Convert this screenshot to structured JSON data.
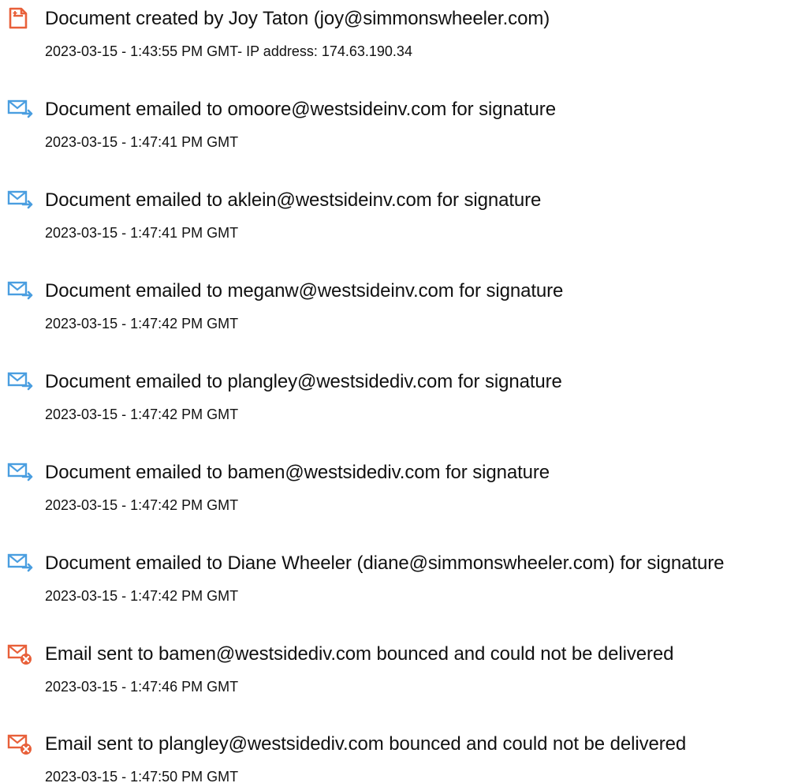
{
  "entries": [
    {
      "icon": "document-created-icon",
      "title": "Document created by Joy Taton (joy@simmonswheeler.com)",
      "meta": "2023-03-15 - 1:43:55 PM GMT- IP address: 174.63.190.34"
    },
    {
      "icon": "email-sent-icon",
      "title": "Document emailed to omoore@westsideinv.com for signature",
      "meta": "2023-03-15 - 1:47:41 PM GMT"
    },
    {
      "icon": "email-sent-icon",
      "title": "Document emailed to aklein@westsideinv.com for signature",
      "meta": "2023-03-15 - 1:47:41 PM GMT"
    },
    {
      "icon": "email-sent-icon",
      "title": "Document emailed to meganw@westsideinv.com for signature",
      "meta": "2023-03-15 - 1:47:42 PM GMT"
    },
    {
      "icon": "email-sent-icon",
      "title": "Document emailed to plangley@westsidediv.com for signature",
      "meta": "2023-03-15 - 1:47:42 PM GMT"
    },
    {
      "icon": "email-sent-icon",
      "title": "Document emailed to bamen@westsidediv.com for signature",
      "meta": "2023-03-15 - 1:47:42 PM GMT"
    },
    {
      "icon": "email-sent-icon",
      "title": "Document emailed to Diane Wheeler (diane@simmonswheeler.com) for signature",
      "meta": "2023-03-15 - 1:47:42 PM GMT"
    },
    {
      "icon": "email-bounced-icon",
      "title": "Email sent to bamen@westsidediv.com bounced and could not be delivered",
      "meta": "2023-03-15 - 1:47:46 PM GMT"
    },
    {
      "icon": "email-bounced-icon",
      "title": "Email sent to plangley@westsidediv.com bounced and could not be delivered",
      "meta": "2023-03-15 - 1:47:50 PM GMT"
    }
  ],
  "colors": {
    "created_icon": "#e8603a",
    "email_icon": "#4a9ee0",
    "bounced_icon": "#e8603a"
  }
}
